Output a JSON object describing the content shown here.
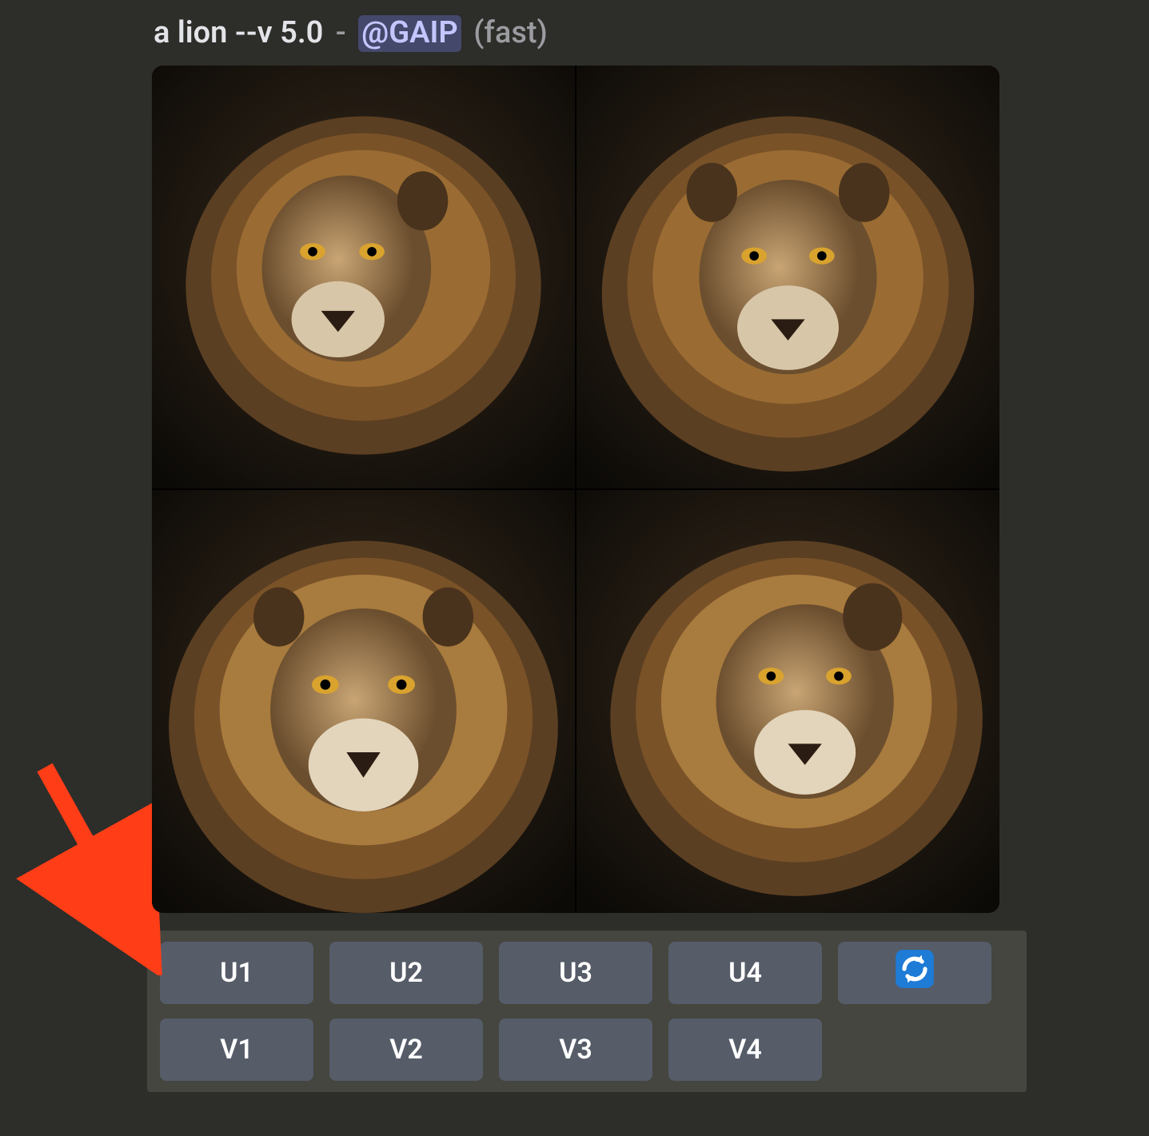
{
  "prompt": {
    "text": "a lion --v 5.0",
    "separator": "-",
    "mention": "@GAIP",
    "mode": "(fast)"
  },
  "image_grid": {
    "subject": "lion",
    "tile_count": 4
  },
  "buttons": {
    "upscale": [
      "U1",
      "U2",
      "U3",
      "U4"
    ],
    "refresh_icon": "refresh-icon",
    "variation": [
      "V1",
      "V2",
      "V3",
      "V4"
    ]
  },
  "annotation": {
    "arrow_color": "#ff3d17",
    "points_to": "upscale-buttons"
  }
}
